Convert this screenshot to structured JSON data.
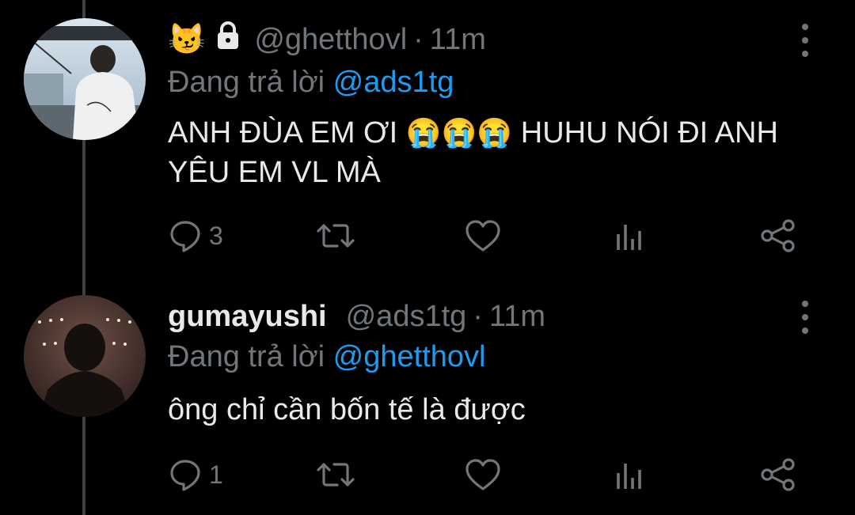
{
  "colors": {
    "background": "#000000",
    "text": "#e7e9ea",
    "muted": "#71767b",
    "link": "#1d9bf0",
    "thread_line": "#3d4145"
  },
  "tweets": [
    {
      "display_name_emoji": "😼",
      "protected": true,
      "handle": "@ghetthovl",
      "separator": "·",
      "time": "11m",
      "reply_prefix": "Đang trả lời",
      "reply_to": "@ads1tg",
      "text_part1": "ANH ĐÙA EM ƠI",
      "emojis": [
        "😭",
        "😭",
        "😭"
      ],
      "text_part2": "HUHU NÓI ĐI ANH YÊU EM VL MÀ",
      "reply_count": "3",
      "icons": [
        "reply-icon",
        "retweet-icon",
        "like-icon",
        "stats-icon",
        "share-icon",
        "more-icon"
      ]
    },
    {
      "display_name": "gumayushi",
      "handle": "@ads1tg",
      "separator": "·",
      "time": "11m",
      "reply_prefix": "Đang trả lời",
      "reply_to": "@ghetthovl",
      "text": "ông chỉ cần bốn tế là được",
      "reply_count": "1",
      "icons": [
        "reply-icon",
        "retweet-icon",
        "like-icon",
        "stats-icon",
        "share-icon",
        "more-icon"
      ]
    }
  ]
}
